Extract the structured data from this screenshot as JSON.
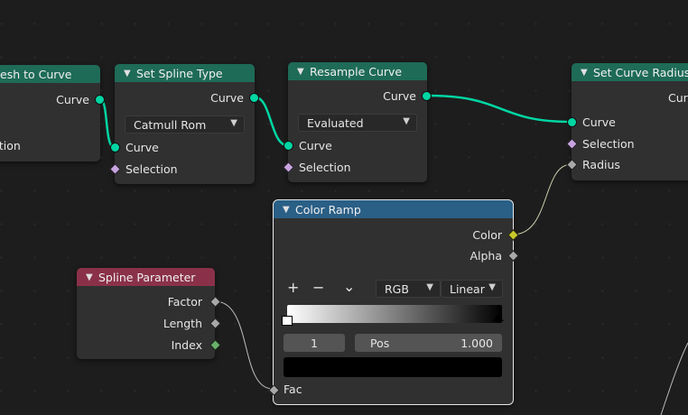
{
  "nodes": {
    "mesh_to_curve": {
      "title": "Mesh to Curve",
      "title_visible": "esh to Curve",
      "out_curve": "Curve",
      "selection_partial": "ction"
    },
    "set_spline_type": {
      "title": "Set Spline Type",
      "out_curve": "Curve",
      "dropdown": "Catmull Rom",
      "in_curve": "Curve",
      "in_selection": "Selection"
    },
    "resample_curve": {
      "title": "Resample Curve",
      "out_curve": "Curve",
      "dropdown": "Evaluated",
      "in_curve": "Curve",
      "in_selection": "Selection"
    },
    "set_curve_radius": {
      "title": "Set Curve Radius",
      "out_curve_partial": "Curv",
      "in_curve": "Curve",
      "in_selection": "Selection",
      "in_radius": "Radius"
    },
    "color_ramp": {
      "title": "Color Ramp",
      "out_color": "Color",
      "out_alpha": "Alpha",
      "add": "+",
      "remove": "−",
      "menu": "⌄",
      "color_mode": "RGB",
      "interpolation": "Linear",
      "stop_index": "1",
      "pos_label": "Pos",
      "pos_value": "1.000",
      "in_fac": "Fac"
    },
    "spline_parameter": {
      "title": "Spline Parameter",
      "out_factor": "Factor",
      "out_length": "Length",
      "out_index": "Index"
    }
  },
  "colors": {
    "geometry_header": "#1e6b57",
    "color_header": "#2a5f86",
    "input_header": "#8a3149",
    "geometry_socket": "#00d6a3",
    "field_socket": "#c7a3e0",
    "float_socket": "#a8a8a8",
    "color_socket": "#c7c729",
    "int_socket": "#67b06a"
  }
}
